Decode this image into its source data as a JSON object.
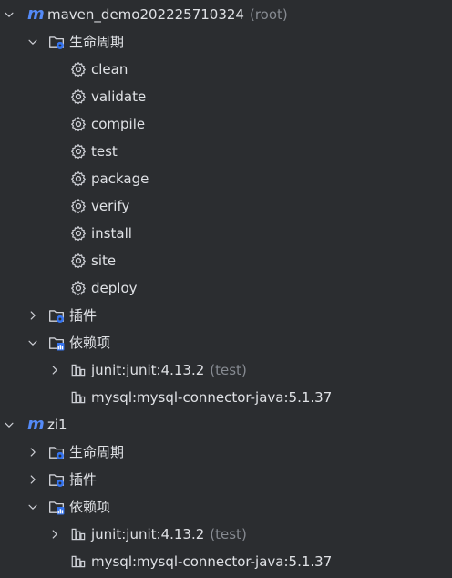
{
  "colors": {
    "background": "#2b2d30",
    "text": "#dfe1e5",
    "muted": "#868a91",
    "maven_blue": "#548af7",
    "folder_accent": "#3574f0"
  },
  "projects": [
    {
      "name": "maven_demo202225710324",
      "suffix": "(root)",
      "expanded": true,
      "lifecycle": {
        "label": "生命周期",
        "expanded": true,
        "phases": [
          "clean",
          "validate",
          "compile",
          "test",
          "package",
          "verify",
          "install",
          "site",
          "deploy"
        ]
      },
      "plugins": {
        "label": "插件",
        "expanded": false
      },
      "dependencies": {
        "label": "依赖项",
        "expanded": true,
        "items": [
          {
            "name": "junit:junit:4.13.2",
            "scope": "(test)",
            "expandable": true
          },
          {
            "name": "mysql:mysql-connector-java:5.1.37",
            "scope": "",
            "expandable": false
          }
        ]
      }
    },
    {
      "name": "zi1",
      "suffix": "",
      "expanded": true,
      "lifecycle": {
        "label": "生命周期",
        "expanded": false
      },
      "plugins": {
        "label": "插件",
        "expanded": false
      },
      "dependencies": {
        "label": "依赖项",
        "expanded": true,
        "items": [
          {
            "name": "junit:junit:4.13.2",
            "scope": "(test)",
            "expandable": true
          },
          {
            "name": "mysql:mysql-connector-java:5.1.37",
            "scope": "",
            "expandable": false
          }
        ]
      }
    }
  ]
}
